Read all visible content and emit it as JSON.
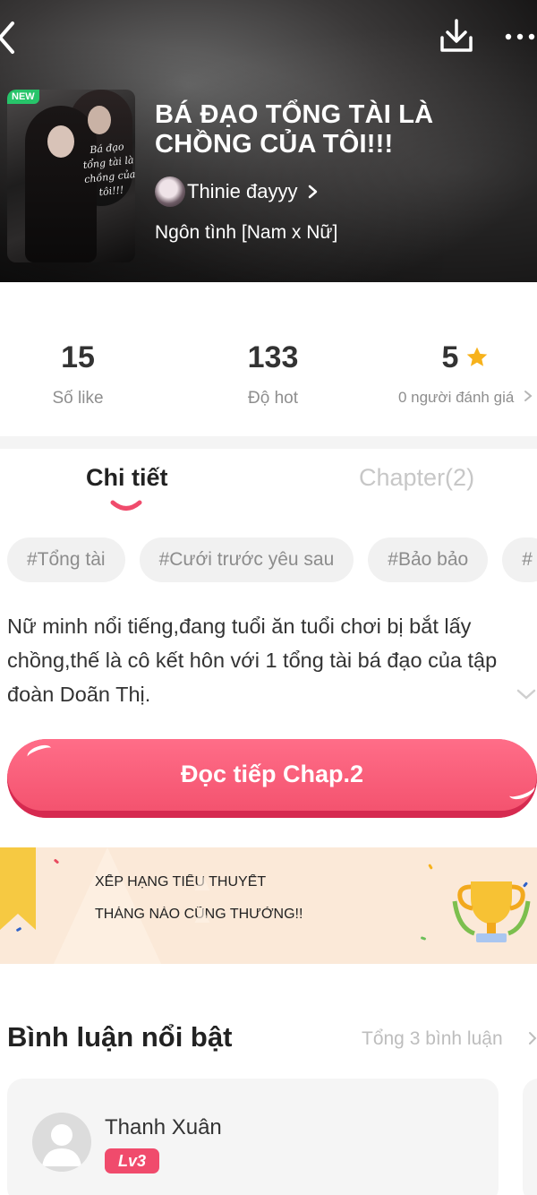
{
  "header": {
    "new_badge": "NEW",
    "title": "BÁ ĐẠO TỔNG TÀI LÀ CHỒNG CỦA TÔI!!!",
    "author": "Thinie đayyy",
    "genre": "Ngôn tình [Nam x Nữ]",
    "cover_script": "Bá đạo tổng tài là chồng của tôi!!!"
  },
  "stats": {
    "likes_value": "15",
    "likes_label": "Số like",
    "hot_value": "133",
    "hot_label": "Độ hot",
    "rating_value": "5",
    "rating_label": "0 người đánh giá"
  },
  "tabs": {
    "detail": "Chi tiết",
    "chapter": "Chapter(2)"
  },
  "tags": [
    "#Tổng tài",
    "#Cưới trước yêu sau",
    "#Bảo bảo",
    "#"
  ],
  "description": "Nữ minh nổi tiếng,đang tuổi ăn tuổi chơi bị bắt lấy chồng,thế là cô kết hôn với 1 tổng tài bá đạo của tập đoàn Doãn Thị.",
  "read_button": "Đọc tiếp Chap.2",
  "banner": {
    "line1": "XẾP HẠNG TIỂU THUYẾT",
    "line2": "THÁNG NÀO CŨNG THƯỞNG!!"
  },
  "comments": {
    "title": "Bình luận nổi bật",
    "total": "Tổng 3 bình luận",
    "items": [
      {
        "user": "Thanh Xuân",
        "level": "Lv3"
      }
    ]
  },
  "colors": {
    "accent": "#f4536f",
    "banner_text": "#2f62c9",
    "star": "#f7b21b"
  }
}
